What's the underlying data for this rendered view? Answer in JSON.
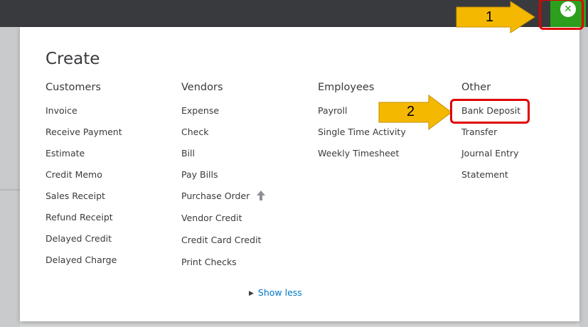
{
  "create": {
    "title": "Create",
    "columns": [
      {
        "heading": "Customers",
        "items": [
          "Invoice",
          "Receive Payment",
          "Estimate",
          "Credit Memo",
          "Sales Receipt",
          "Refund Receipt",
          "Delayed Credit",
          "Delayed Charge"
        ]
      },
      {
        "heading": "Vendors",
        "items": [
          "Expense",
          "Check",
          "Bill",
          "Pay Bills",
          "Purchase Order",
          "Vendor Credit",
          "Credit Card Credit",
          "Print Checks"
        ]
      },
      {
        "heading": "Employees",
        "items": [
          "Payroll",
          "Single Time Activity",
          "Weekly Timesheet"
        ]
      },
      {
        "heading": "Other",
        "items": [
          "Bank Deposit",
          "Transfer",
          "Journal Entry",
          "Statement"
        ]
      }
    ],
    "show_less": "Show less"
  },
  "close_icon": "close-x-icon",
  "annotations": {
    "step1": "1",
    "step2": "2"
  },
  "colors": {
    "topbar": "#393a3d",
    "brand_green": "#2ca01c",
    "link_blue": "#0077c5",
    "highlight_red": "#e00000",
    "arrow_yellow": "#f5b800"
  }
}
